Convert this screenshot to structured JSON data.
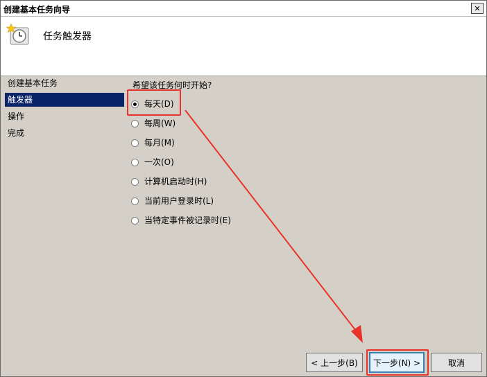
{
  "window": {
    "title": "创建基本任务向导",
    "close_icon": "close-icon"
  },
  "header": {
    "title": "任务触发器",
    "icon": "clock-icon"
  },
  "sidebar": {
    "items": [
      {
        "label": "创建基本任务",
        "active": false
      },
      {
        "label": "触发器",
        "active": true
      },
      {
        "label": "操作",
        "active": false
      },
      {
        "label": "完成",
        "active": false
      }
    ]
  },
  "main": {
    "prompt": "希望该任务何时开始?",
    "options": [
      {
        "label": "每天(D)",
        "selected": true
      },
      {
        "label": "每周(W)",
        "selected": false
      },
      {
        "label": "每月(M)",
        "selected": false
      },
      {
        "label": "一次(O)",
        "selected": false
      },
      {
        "label": "计算机启动时(H)",
        "selected": false
      },
      {
        "label": "当前用户登录时(L)",
        "selected": false
      },
      {
        "label": "当特定事件被记录时(E)",
        "selected": false
      }
    ]
  },
  "buttons": {
    "back": "< 上一步(B)",
    "next": "下一步(N) >",
    "cancel": "取消"
  },
  "colors": {
    "highlight": "#e8332a",
    "selection": "#0a246a"
  }
}
